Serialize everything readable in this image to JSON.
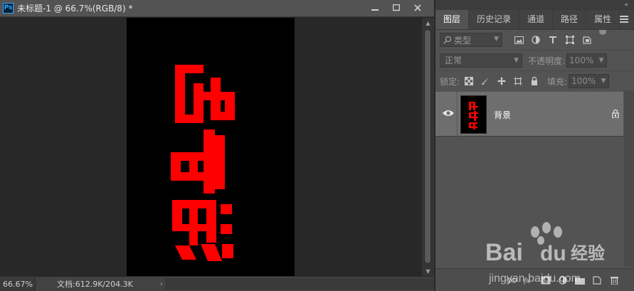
{
  "app": {
    "logo_text": "Ps"
  },
  "document": {
    "title": "未标题-1 @ 66.7%(RGB/8) *",
    "canvas_text": [
      "字",
      "血",
      "滴"
    ],
    "text_color": "#ff0000",
    "canvas_bg": "#000000"
  },
  "window_buttons": {
    "minimize": "minimize-icon",
    "maximize": "maximize-icon",
    "close": "close-icon"
  },
  "statusbar": {
    "zoom": "66.67%",
    "doc_info": "文档:612.9K/204.3K",
    "arrow": "›"
  },
  "panel": {
    "collapse": "«",
    "tabs": [
      "图层",
      "历史记录",
      "通道",
      "路径",
      "属性"
    ],
    "active_tab": 0,
    "filter": {
      "kind": "类型"
    },
    "blend_mode": "正常",
    "opacity": {
      "label": "不透明度:",
      "value": "100%"
    },
    "lock": {
      "label": "锁定:"
    },
    "fill": {
      "label": "填充:",
      "value": "100%"
    },
    "layers": [
      {
        "name": "背景",
        "visible": true,
        "locked": true
      }
    ]
  },
  "watermark": {
    "brand": "Bai",
    "brand2": "du",
    "cn": "经验",
    "url": "jingyan.baidu.com"
  }
}
